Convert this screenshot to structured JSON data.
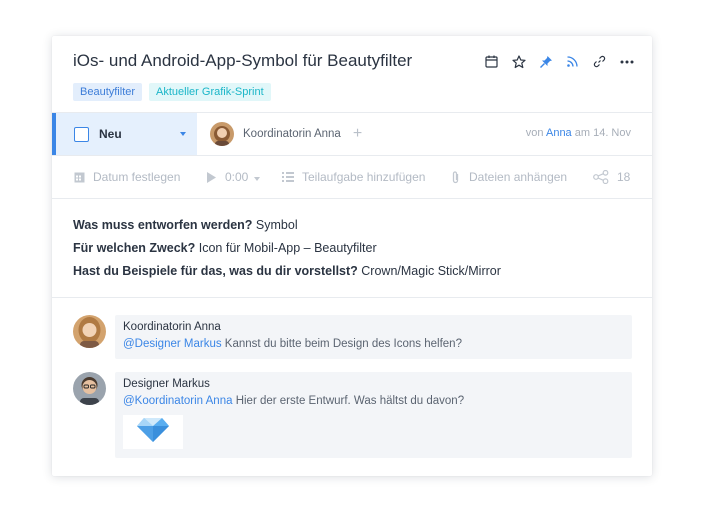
{
  "task": {
    "title": "iOs- und Android-App-Symbol für Beautyfilter",
    "tags": [
      {
        "label": "Beautyfilter",
        "color": "#3d7dd8"
      },
      {
        "label": "Aktueller Grafik-Sprint",
        "color": "#1bb6c8"
      }
    ],
    "header_icons": [
      "calendar-icon",
      "star-icon",
      "pin-icon",
      "rss-icon",
      "link-icon",
      "more-icon"
    ]
  },
  "status": {
    "label": "Neu",
    "assignee": "Koordinatorin Anna",
    "meta_prefix": "von",
    "meta_author": "Anna",
    "meta_suffix": "am 14. Nov"
  },
  "toolbar": {
    "date": "Datum festlegen",
    "timer": "0:00",
    "subtask": "Teilaufgabe hinzufügen",
    "files": "Dateien anhängen",
    "share_count": "18"
  },
  "description": [
    {
      "q": "Was muss entworfen werden?",
      "a": "Symbol"
    },
    {
      "q": "Für welchen Zweck?",
      "a": "Icon für Mobil-App – Beautyfilter"
    },
    {
      "q": "Hast du Beispiele für das, was du dir vorstellst?",
      "a": "Crown/Magic Stick/Mirror"
    }
  ],
  "comments": [
    {
      "author": "Koordinatorin Anna",
      "mention": "@Designer Markus",
      "text": " Kannst du bitte beim Design des Icons helfen?"
    },
    {
      "author": "Designer Markus",
      "mention": "@Koordinatorin Anna",
      "text": " Hier der erste Entwurf. Was hältst du davon?",
      "attachment": "diamond-icon"
    }
  ],
  "colors": {
    "accent": "#3b86e6",
    "status_bg": "#e5f0fd",
    "bubble": "#f3f5f8"
  }
}
